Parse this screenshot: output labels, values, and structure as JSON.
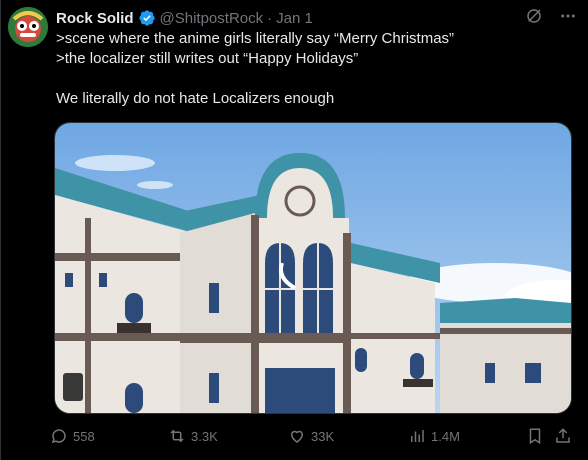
{
  "tweet": {
    "author_name": "Rock Solid",
    "handle": "@ShitpostRock",
    "separator": "·",
    "date": "Jan 1",
    "lines": [
      ">scene where the anime girls literally say “Merry Christmas”",
      ">the localizer still writes out “Happy Holidays”",
      "We literally do not hate Localizers enough"
    ]
  },
  "actions": {
    "replies": "558",
    "reposts": "3.3K",
    "likes": "33K",
    "views": "1.4M"
  },
  "colors": {
    "verified_blue": "#1d9bf0",
    "text_primary": "#e7e9ea",
    "text_secondary": "#71767b",
    "background": "#000000"
  },
  "icons": {
    "top": [
      "grok-icon",
      "more-icon"
    ],
    "actions": [
      "reply-icon",
      "repost-icon",
      "like-icon",
      "views-icon",
      "bookmark-icon",
      "share-icon"
    ]
  }
}
